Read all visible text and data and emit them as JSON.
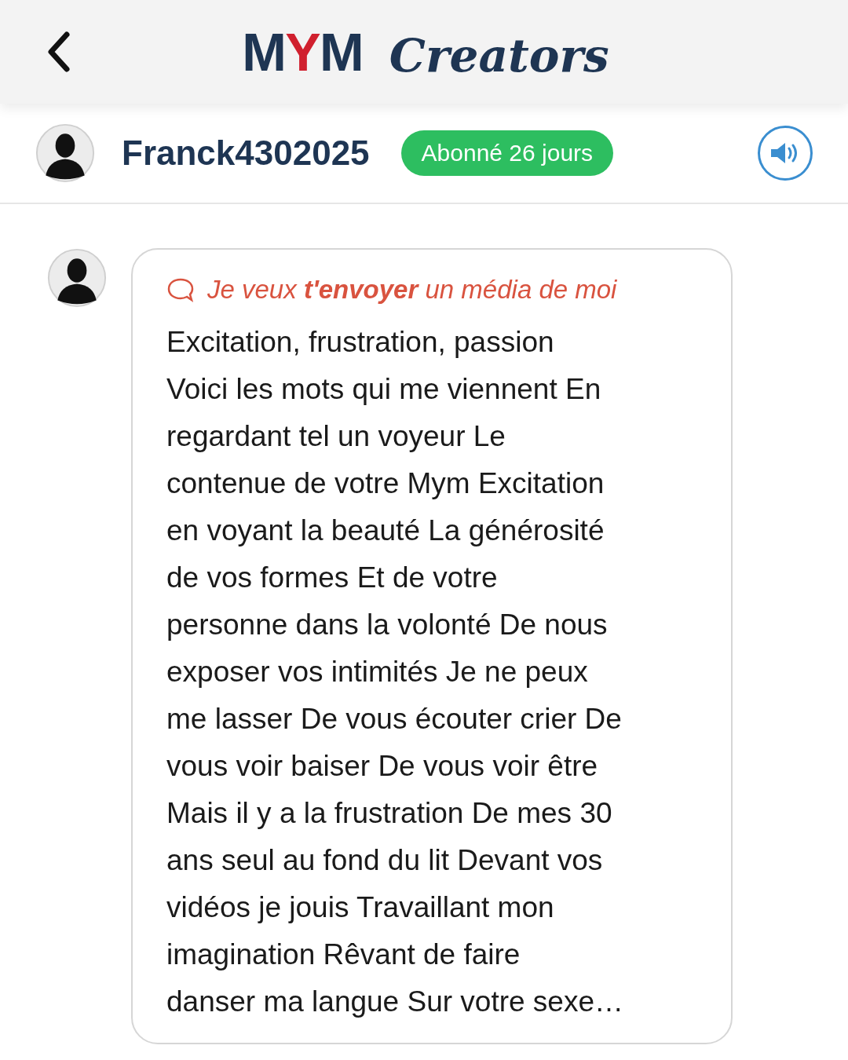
{
  "header": {
    "logo_letters": [
      {
        "char": "M",
        "color": "#1e3553"
      },
      {
        "char": "Y",
        "color": "#d0202e"
      },
      {
        "char": "M",
        "color": "#1e3553"
      }
    ],
    "logo_suffix": "Creators"
  },
  "profile": {
    "username": "Franck4302025",
    "badge": "Abonné 26 jours"
  },
  "message": {
    "title": "Je veux **t'envoyer** un média de moi",
    "lines": [
      "Excitation, frustration, passion",
      "Voici les mots qui me viennent En",
      "regardant tel un voyeur Le",
      "contenue de votre Mym Excitation",
      "en voyant la beauté La générosité",
      "de vos formes Et de votre",
      "personne dans la volonté De nous",
      "exposer vos intimités Je ne peux",
      "me lasser De vous écouter crier De",
      "vous voir baiser De vous voir être",
      "Mais il y a la frustration De mes 30",
      "ans seul au fond du lit Devant vos",
      "vidéos je jouis Travaillant mon",
      "imagination Rêvant de faire",
      "danser ma langue Sur votre sexe…"
    ]
  }
}
